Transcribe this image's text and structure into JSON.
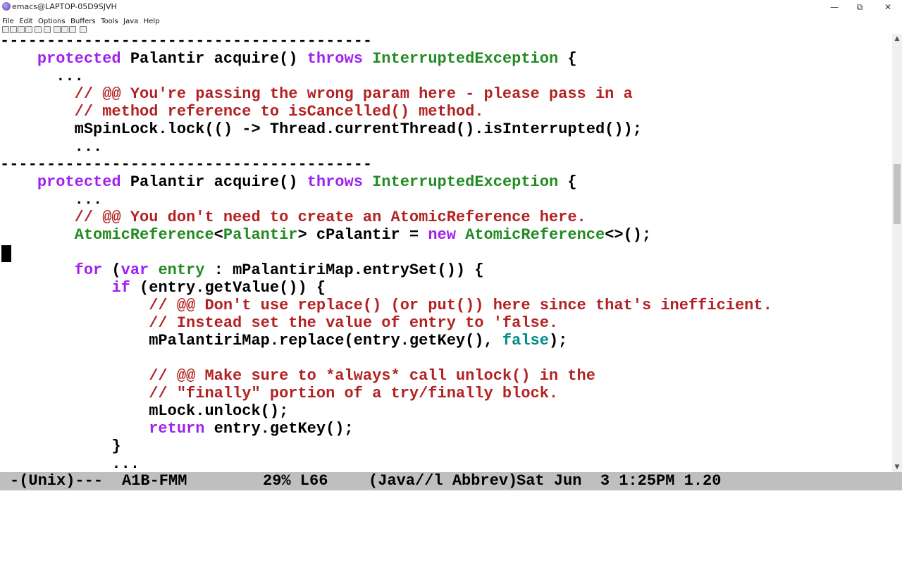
{
  "window": {
    "title": "emacs@LAPTOP-05D9SJVH",
    "minimize_icon": "minimize-icon",
    "restore_icon": "restore-icon",
    "close_icon": "close-icon"
  },
  "menu": [
    "File",
    "Edit",
    "Options",
    "Buffers",
    "Tools",
    "Java",
    "Help"
  ],
  "code": {
    "l1": "----------------------------------------",
    "l2_indent": "    ",
    "l2_kw": "protected",
    "l2_a": " Palantir acquire() ",
    "l2_kw2": "throws",
    "l2_sp": " ",
    "l2_ty": "InterruptedException",
    "l2_end": " {",
    "l3": "      ...",
    "l4_indent": "        ",
    "l4": "// @@ You're passing the wrong param here - please pass in a",
    "l5_indent": "        ",
    "l5": "// method reference to isCancelled() method.",
    "l6": "        mSpinLock.lock(() -> Thread.currentThread().isInterrupted());",
    "l7": "        ...",
    "l8": "----------------------------------------",
    "l9_indent": "    ",
    "l9_kw": "protected",
    "l9_a": " Palantir acquire() ",
    "l9_kw2": "throws",
    "l9_sp": " ",
    "l9_ty": "InterruptedException",
    "l9_end": " {",
    "l10": "        ...",
    "l11_indent": "        ",
    "l11": "// @@ You don't need to create an AtomicReference here.",
    "l12_indent": "        ",
    "l12_ty": "AtomicReference",
    "l12_a": "<",
    "l12_ty2": "Palantir",
    "l12_b": "> cPalantir = ",
    "l12_kw": "new",
    "l12_sp": " ",
    "l12_ty3": "AtomicReference",
    "l12_c": "<>();",
    "l14_indent": "        ",
    "l14_kw": "for",
    "l14_a": " (",
    "l14_kw2": "var",
    "l14_sp": " ",
    "l14_ty": "entry",
    "l14_b": " : mPalantiriMap.entrySet()) {",
    "l15_indent": "            ",
    "l15_kw": "if",
    "l15_a": " (entry.getValue()) {",
    "l16_indent": "                ",
    "l16": "// @@ Don't use replace() (or put()) here since that's inefficient.",
    "l17_indent": "                ",
    "l17": "// Instead set the value of entry to 'false.",
    "l18_a": "                mPalantiriMap.replace(entry.getKey(), ",
    "l18_cst": "false",
    "l18_b": ");",
    "l20_indent": "                ",
    "l20": "// @@ Make sure to *always* call unlock() in the",
    "l21_indent": "                ",
    "l21": "// \"finally\" portion of a try/finally block.",
    "l22": "                mLock.unlock();",
    "l23_indent": "                ",
    "l23_kw": "return",
    "l23_a": " entry.getKey();",
    "l24": "            }",
    "l25": "            ..."
  },
  "modeline": {
    "status": "-(Unix)---",
    "buffer": "A1B-FMM",
    "position": "29% L66",
    "modes": "(Java//l Abbrev)",
    "time": "Sat Jun  3 1:25PM 1.20"
  }
}
